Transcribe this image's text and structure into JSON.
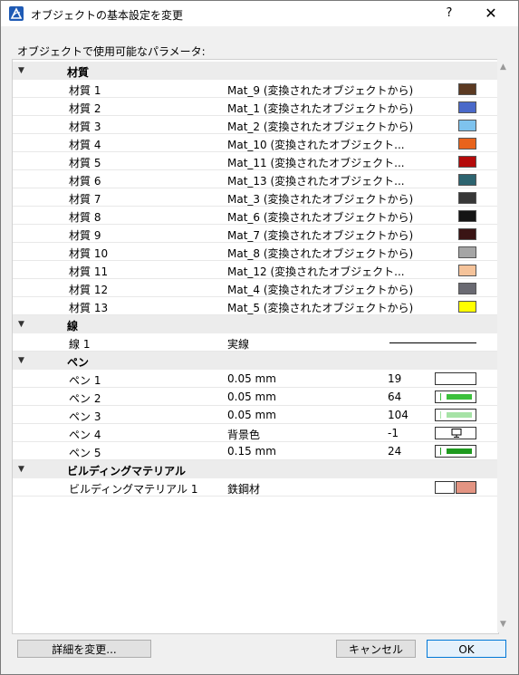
{
  "window": {
    "title": "オブジェクトの基本設定を変更",
    "help": "?",
    "close": "✕"
  },
  "param_label": "オブジェクトで使用可能なパラメータ:",
  "sections": {
    "materials": {
      "title": "材質",
      "items": [
        {
          "name": "材質 1",
          "value": "Mat_9 (変換されたオブジェクトから)",
          "color": "#5c3a22"
        },
        {
          "name": "材質 2",
          "value": "Mat_1 (変換されたオブジェクトから)",
          "color": "#4a69c9"
        },
        {
          "name": "材質 3",
          "value": "Mat_2 (変換されたオブジェクトから)",
          "color": "#7ec3ee"
        },
        {
          "name": "材質 4",
          "value": "Mat_10 (変換されたオブジェクト...",
          "color": "#e8631c"
        },
        {
          "name": "材質 5",
          "value": "Mat_11 (変換されたオブジェクト...",
          "color": "#b40a0a"
        },
        {
          "name": "材質 6",
          "value": "Mat_13 (変換されたオブジェクト...",
          "color": "#2d6470"
        },
        {
          "name": "材質 7",
          "value": "Mat_3 (変換されたオブジェクトから)",
          "color": "#373737"
        },
        {
          "name": "材質 8",
          "value": "Mat_6 (変換されたオブジェクトから)",
          "color": "#141414"
        },
        {
          "name": "材質 9",
          "value": "Mat_7 (変換されたオブジェクトから)",
          "color": "#3a1414"
        },
        {
          "name": "材質 10",
          "value": "Mat_8 (変換されたオブジェクトから)",
          "color": "#a5a5a5"
        },
        {
          "name": "材質 11",
          "value": "Mat_12 (変換されたオブジェクト...",
          "color": "#f5c39a"
        },
        {
          "name": "材質 12",
          "value": "Mat_4 (変換されたオブジェクトから)",
          "color": "#6a6a72"
        },
        {
          "name": "材質 13",
          "value": "Mat_5 (変換されたオブジェクトから)",
          "color": "#ffff00"
        }
      ]
    },
    "lines": {
      "title": "線",
      "items": [
        {
          "name": "線 1",
          "value": "実線"
        }
      ]
    },
    "pens": {
      "title": "ペン",
      "items": [
        {
          "name": "ペン 1",
          "value": "0.05 mm",
          "num": "19",
          "color": ""
        },
        {
          "name": "ペン 2",
          "value": "0.05 mm",
          "num": "64",
          "color": "#3cc03c"
        },
        {
          "name": "ペン 3",
          "value": "0.05 mm",
          "num": "104",
          "color": "#a6e3a6"
        },
        {
          "name": "ペン 4",
          "value": "背景色",
          "num": "-1",
          "color": "monitor"
        },
        {
          "name": "ペン 5",
          "value": "0.15 mm",
          "num": "24",
          "color": "#1e9a1e"
        }
      ]
    },
    "building": {
      "title": "ビルディングマテリアル",
      "items": [
        {
          "name": "ビルディングマテリアル 1",
          "value": "鉄鋼材",
          "color": "#e39482"
        }
      ]
    }
  },
  "footer": {
    "details": "詳細を変更...",
    "cancel": "キャンセル",
    "ok": "OK"
  }
}
